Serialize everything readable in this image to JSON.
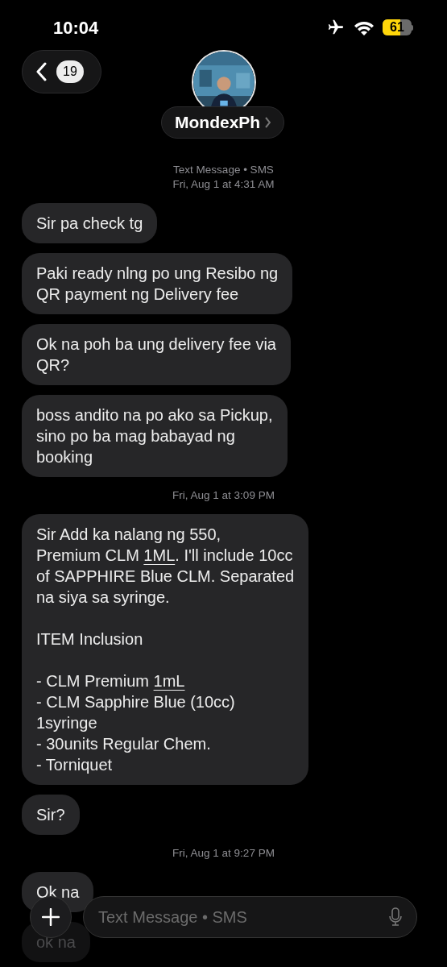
{
  "status_bar": {
    "time": "10:04",
    "battery": "61"
  },
  "header": {
    "back_count": "19",
    "contact_name": "MondexPh"
  },
  "thread": [
    {
      "kind": "timestamp",
      "lines": [
        "Text Message • SMS",
        "Fri, Aug 1 at 4:31 AM"
      ]
    },
    {
      "kind": "message",
      "parts": [
        {
          "text": "Sir pa check tg",
          "underline": false
        }
      ]
    },
    {
      "kind": "message",
      "parts": [
        {
          "text": "Paki ready nlng po ung Resibo ng\nQR payment ng Delivery fee",
          "underline": false
        }
      ]
    },
    {
      "kind": "message",
      "parts": [
        {
          "text": "Ok na poh ba ung delivery fee via\nQR?",
          "underline": false
        }
      ]
    },
    {
      "kind": "message",
      "parts": [
        {
          "text": "boss andito na po ako sa Pickup,\nsino po ba mag babayad ng\nbooking",
          "underline": false
        }
      ]
    },
    {
      "kind": "timestamp",
      "lines": [
        "Fri, Aug 1 at 3:09 PM"
      ]
    },
    {
      "kind": "message",
      "parts": [
        {
          "text": "Sir Add ka nalang ng 550,\nPremium CLM ",
          "underline": false
        },
        {
          "text": "1ML",
          "underline": true
        },
        {
          "text": ". I'll include 10cc\nof SAPPHIRE Blue CLM. Separated\nna siya sa syringe.\n\nITEM Inclusion\n\n- CLM Premium ",
          "underline": false
        },
        {
          "text": "1mL",
          "underline": true
        },
        {
          "text": "\n- CLM Sapphire Blue (10cc)\n1syringe\n- 30units Regular Chem.\n- Torniquet",
          "underline": false
        }
      ]
    },
    {
      "kind": "message",
      "parts": [
        {
          "text": "Sir?",
          "underline": false
        }
      ]
    },
    {
      "kind": "timestamp",
      "lines": [
        "Fri, Aug 1 at 9:27 PM"
      ]
    },
    {
      "kind": "message",
      "parts": [
        {
          "text": "Ok na",
          "underline": false
        }
      ]
    },
    {
      "kind": "faded_message",
      "parts": [
        {
          "text": "ok na",
          "underline": false
        }
      ]
    }
  ],
  "composer": {
    "placeholder": "Text Message • SMS"
  }
}
